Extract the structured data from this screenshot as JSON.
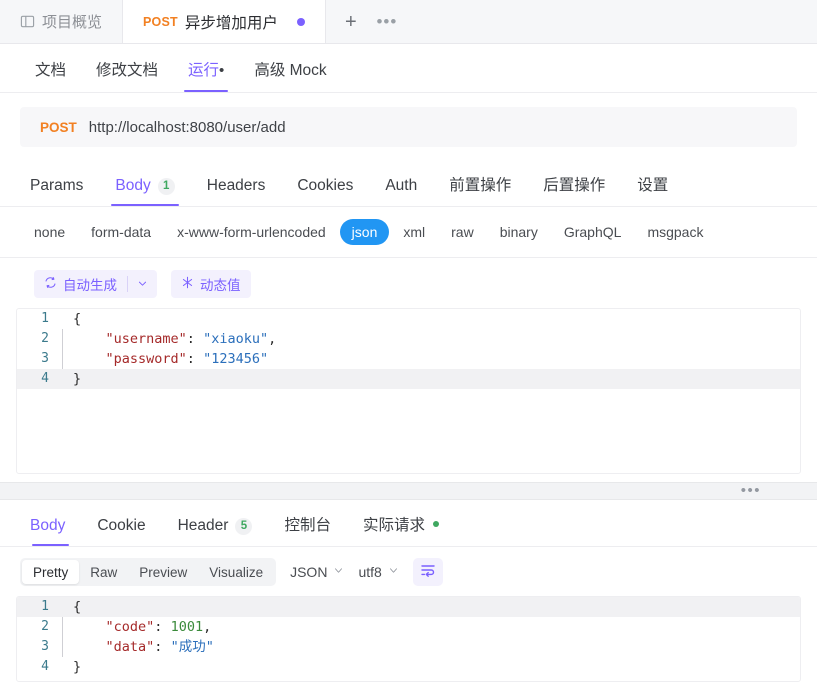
{
  "window_tabs": {
    "items": [
      {
        "label": "项目概览",
        "icon": "layout-panel-icon",
        "active": false
      },
      {
        "method": "POST",
        "label": "异步增加用户",
        "active": true,
        "unsaved_dot": true
      }
    ],
    "add_label": "+",
    "more_label": "•••"
  },
  "doc_tabs": [
    {
      "label": "文档",
      "active": false
    },
    {
      "label": "修改文档",
      "active": false
    },
    {
      "label": "运行",
      "suffix": "•",
      "active": true
    },
    {
      "label": "高级 Mock",
      "active": false
    }
  ],
  "urlbar": {
    "method": "POST",
    "url": "http://localhost:8080/user/add"
  },
  "request_tabs": [
    {
      "label": "Params",
      "active": false
    },
    {
      "label": "Body",
      "badge": "1",
      "active": true
    },
    {
      "label": "Headers",
      "active": false
    },
    {
      "label": "Cookies",
      "active": false
    },
    {
      "label": "Auth",
      "active": false
    },
    {
      "label": "前置操作",
      "active": false
    },
    {
      "label": "后置操作",
      "active": false
    },
    {
      "label": "设置",
      "active": false
    }
  ],
  "body_types": [
    {
      "label": "none",
      "active": false
    },
    {
      "label": "form-data",
      "active": false
    },
    {
      "label": "x-www-form-urlencoded",
      "active": false
    },
    {
      "label": "json",
      "active": true
    },
    {
      "label": "xml",
      "active": false
    },
    {
      "label": "raw",
      "active": false
    },
    {
      "label": "binary",
      "active": false
    },
    {
      "label": "GraphQL",
      "active": false
    },
    {
      "label": "msgpack",
      "active": false
    }
  ],
  "gen_toolbar": {
    "auto_generate_label": "自动生成",
    "auto_generate_icon": "sync-icon",
    "caret_icon": "chevron-down-icon",
    "dynamic_value_label": "动态值",
    "dynamic_value_icon": "sparkle-icon"
  },
  "request_body_editor": {
    "language": "json",
    "active_line": 4,
    "lines": [
      {
        "no": "1",
        "tokens": [
          {
            "t": "{",
            "c": "k-brace"
          }
        ]
      },
      {
        "no": "2",
        "indent": true,
        "tokens": [
          {
            "t": "\"username\"",
            "c": "k-key"
          },
          {
            "t": ": ",
            "c": "k-punc"
          },
          {
            "t": "\"xiaoku\"",
            "c": "k-str"
          },
          {
            "t": ",",
            "c": "k-punc"
          }
        ]
      },
      {
        "no": "3",
        "indent": true,
        "tokens": [
          {
            "t": "\"password\"",
            "c": "k-key"
          },
          {
            "t": ": ",
            "c": "k-punc"
          },
          {
            "t": "\"123456\"",
            "c": "k-str"
          }
        ]
      },
      {
        "no": "4",
        "tokens": [
          {
            "t": "}",
            "c": "k-brace"
          }
        ]
      }
    ]
  },
  "splitter": {
    "handle": "•••"
  },
  "response_tabs": [
    {
      "label": "Body",
      "active": true
    },
    {
      "label": "Cookie",
      "active": false
    },
    {
      "label": "Header",
      "badge": "5",
      "active": false
    },
    {
      "label": "控制台",
      "active": false
    },
    {
      "label": "实际请求",
      "green_dot": true,
      "active": false
    }
  ],
  "response_toolbar": {
    "views": [
      {
        "label": "Pretty",
        "active": true
      },
      {
        "label": "Raw",
        "active": false
      },
      {
        "label": "Preview",
        "active": false
      },
      {
        "label": "Visualize",
        "active": false
      }
    ],
    "format_select": "JSON",
    "encoding_select": "utf8",
    "wrap_icon": "word-wrap-icon"
  },
  "response_body_editor": {
    "language": "json",
    "active_line": 1,
    "lines": [
      {
        "no": "1",
        "tokens": [
          {
            "t": "{",
            "c": "k-brace"
          }
        ]
      },
      {
        "no": "2",
        "indent": true,
        "tokens": [
          {
            "t": "\"code\"",
            "c": "k-key"
          },
          {
            "t": ": ",
            "c": "k-punc"
          },
          {
            "t": "1001",
            "c": "k-num"
          },
          {
            "t": ",",
            "c": "k-punc"
          }
        ]
      },
      {
        "no": "3",
        "indent": true,
        "tokens": [
          {
            "t": "\"data\"",
            "c": "k-key"
          },
          {
            "t": ": ",
            "c": "k-punc"
          },
          {
            "t": "\"成功\"",
            "c": "k-str"
          }
        ]
      },
      {
        "no": "4",
        "tokens": [
          {
            "t": "}",
            "c": "k-brace"
          }
        ]
      }
    ]
  },
  "colors": {
    "accent_purple": "#7b61ff",
    "method_orange": "#f28022",
    "json_pill_blue": "#2196f3",
    "badge_green": "#3fa860"
  }
}
